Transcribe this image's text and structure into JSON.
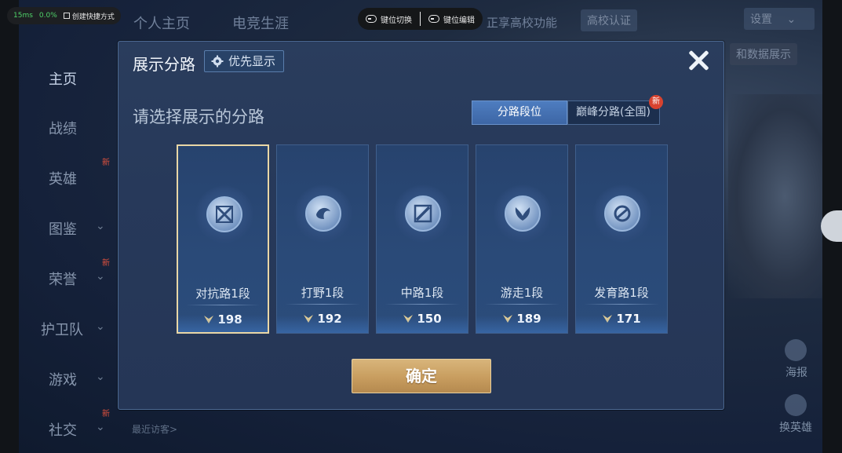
{
  "perf": {
    "latency": "15ms",
    "percent": "0.0%",
    "shortcut": "创建快捷方式"
  },
  "keybar": {
    "switch": "键位切换",
    "edit": "键位编辑"
  },
  "background": {
    "tabs": [
      "个人主页",
      "电竞生涯",
      "正享高校功能"
    ],
    "campus_btn": "高校认证",
    "settings": "设置",
    "data_display": "和数据展示",
    "side_menu": [
      "主页",
      "战绩",
      "英雄",
      "图鉴",
      "荣誉",
      "护卫队",
      "游戏",
      "社交"
    ],
    "new_badge": "新",
    "recent_visitors": "最近访客>",
    "right_labels": [
      "海报",
      "换英雄"
    ]
  },
  "modal": {
    "title": "展示分路",
    "priority_label": "优先显示",
    "subtitle": "请选择展示的分路",
    "segments": [
      "分路段位",
      "巅峰分路(全国)"
    ],
    "segment_new": "新",
    "cards": [
      {
        "label": "对抗路1段",
        "score": "198",
        "selected": true
      },
      {
        "label": "打野1段",
        "score": "192",
        "selected": false
      },
      {
        "label": "中路1段",
        "score": "150",
        "selected": false
      },
      {
        "label": "游走1段",
        "score": "189",
        "selected": false
      },
      {
        "label": "发育路1段",
        "score": "171",
        "selected": false
      }
    ],
    "confirm": "确定"
  },
  "colors": {
    "accent_gold": "#c89d5f",
    "tab_active": "#4e7dc0",
    "badge_red": "#d8432f"
  }
}
